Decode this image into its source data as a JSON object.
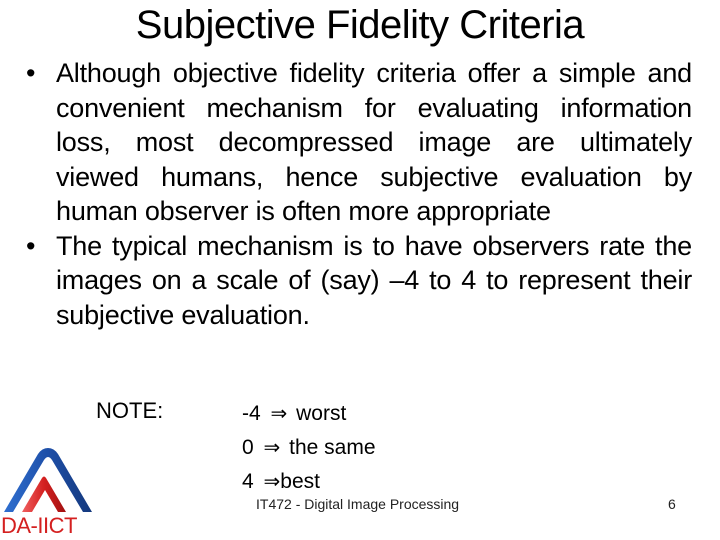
{
  "slide": {
    "title": "Subjective Fidelity Criteria",
    "bullets": [
      {
        "marker": "•",
        "text": "Although objective fidelity criteria offer a simple and convenient mechanism for evaluating information loss, most decompressed image are ultimately viewed humans, hence subjective evaluation by human observer is often more appropriate"
      },
      {
        "marker": "•",
        "text": "The typical mechanism is to have observers rate the images on a scale of (say) –4 to 4 to represent their subjective evaluation."
      }
    ],
    "note": {
      "label": "NOTE:",
      "items": [
        {
          "value": "-4",
          "arrow": "⇒",
          "meaning": "worst"
        },
        {
          "value": "0",
          "arrow": "⇒",
          "meaning": "the same"
        },
        {
          "value": "4",
          "arrow": "⇒",
          "meaning": "best"
        }
      ]
    },
    "footer": {
      "course": "IT472 - Digital Image Processing",
      "page_number": "6"
    },
    "logo": {
      "text": "DA-IICT",
      "colors": {
        "outer": "#1e4fa8",
        "inner": "#d42020"
      }
    }
  }
}
